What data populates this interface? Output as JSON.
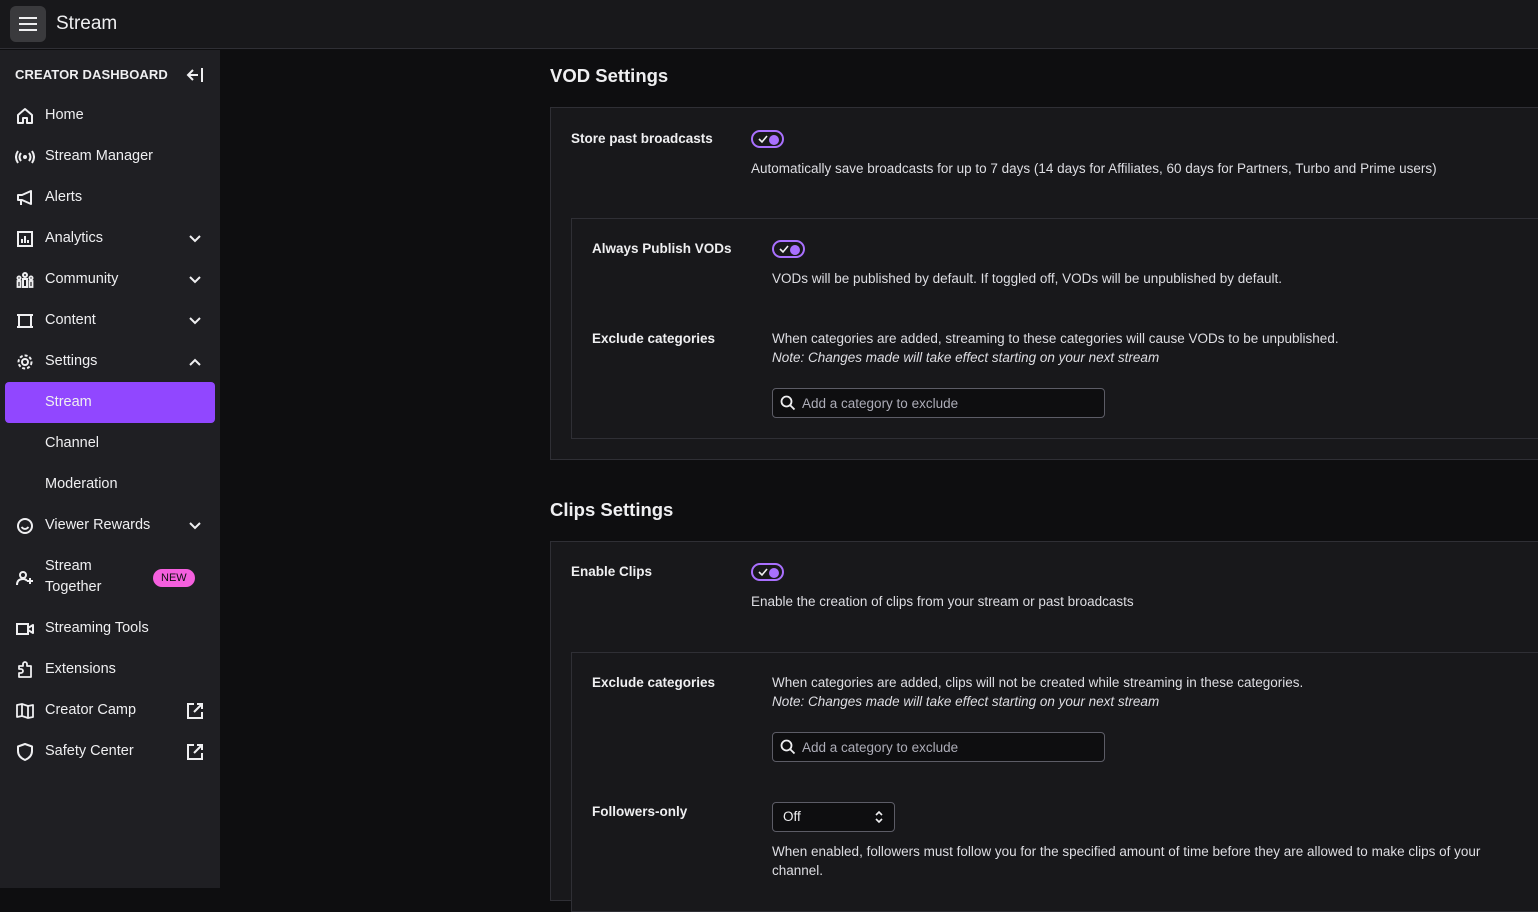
{
  "header": {
    "title": "Stream"
  },
  "sidebar": {
    "heading": "CREATOR DASHBOARD",
    "items": [
      {
        "label": "Home"
      },
      {
        "label": "Stream Manager"
      },
      {
        "label": "Alerts"
      },
      {
        "label": "Analytics"
      },
      {
        "label": "Community"
      },
      {
        "label": "Content"
      },
      {
        "label": "Settings"
      },
      {
        "label": "Stream"
      },
      {
        "label": "Channel"
      },
      {
        "label": "Moderation"
      },
      {
        "label": "Viewer Rewards"
      },
      {
        "label": "Stream Together",
        "line1": "Stream",
        "line2": "Together",
        "badge": "NEW"
      },
      {
        "label": "Streaming Tools"
      },
      {
        "label": "Extensions"
      },
      {
        "label": "Creator Camp"
      },
      {
        "label": "Safety Center"
      }
    ]
  },
  "vod": {
    "title": "VOD Settings",
    "store_label": "Store past broadcasts",
    "store_on": true,
    "store_desc": "Automatically save broadcasts for up to 7 days (14 days for Affiliates, 60 days for Partners, Turbo and Prime users)",
    "publish_label": "Always Publish VODs",
    "publish_on": true,
    "publish_desc": "VODs will be published by default. If toggled off, VODs will be unpublished by default.",
    "exclude_label": "Exclude categories",
    "exclude_desc": "When categories are added, streaming to these categories will cause VODs to be unpublished.",
    "exclude_note": "Note: Changes made will take effect starting on your next stream",
    "exclude_placeholder": "Add a category to exclude"
  },
  "clips": {
    "title": "Clips Settings",
    "enable_label": "Enable Clips",
    "enable_on": true,
    "enable_desc": "Enable the creation of clips from your stream or past broadcasts",
    "exclude_label": "Exclude categories",
    "exclude_desc": "When categories are added, clips will not be created while streaming in these categories.",
    "exclude_note": "Note: Changes made will take effect starting on your next stream",
    "exclude_placeholder": "Add a category to exclude",
    "followers_label": "Followers-only",
    "followers_value": "Off",
    "followers_desc_1": "When enabled, followers must follow you for the specified amount of time before they are allowed to make clips of your",
    "followers_desc_2": "channel."
  },
  "colors": {
    "accent": "#9147ff",
    "toggle": "#a970ff",
    "badge": "#f55fde"
  }
}
